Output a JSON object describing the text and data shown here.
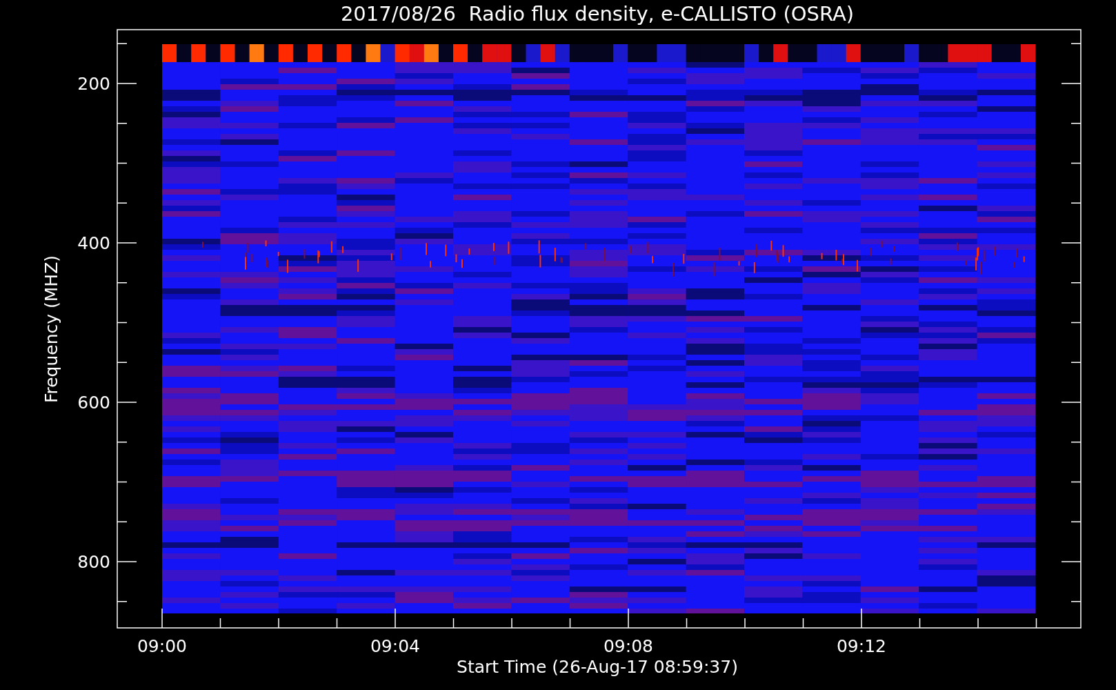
{
  "title": "2017/08/26  Radio flux density, e-CALLISTO (OSRA)",
  "ylabel": "Frequency (MHZ)",
  "xlabel": "Start Time (26-Aug-17 08:59:37)",
  "yticks": [
    "200",
    "400",
    "600",
    "800"
  ],
  "xticks": [
    "09:00",
    "09:04",
    "09:08",
    "09:12"
  ]
}
